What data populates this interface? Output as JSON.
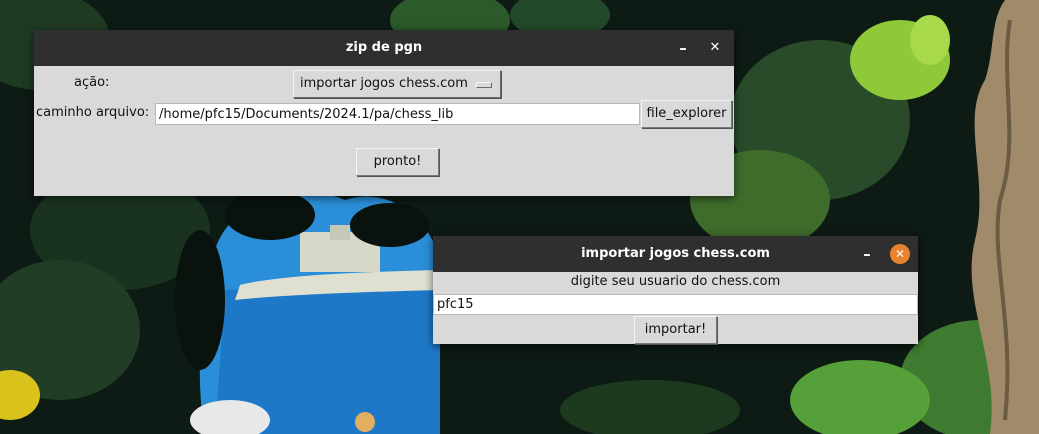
{
  "window_main": {
    "title": "zip de pgn",
    "minimize_glyph": "–",
    "close_glyph": "✕",
    "action_label": "ação:",
    "action_selected": "importar jogos chess.com",
    "path_label": "caminho arquivo:",
    "path_value": "/home/pfc15/Documents/2024.1/pa/chess_lib",
    "explorer_button": "file_explorer",
    "done_button": "pronto!"
  },
  "window_dialog": {
    "title": "importar jogos chess.com",
    "minimize_glyph": "–",
    "close_glyph": "✕",
    "prompt": "digite seu usuario do chess.com",
    "username_value": "pfc15",
    "import_button": "importar!"
  },
  "colors": {
    "titlebar": "#2f2f2f",
    "window_bg": "#d9d9d9",
    "close_accent": "#e8822c"
  }
}
